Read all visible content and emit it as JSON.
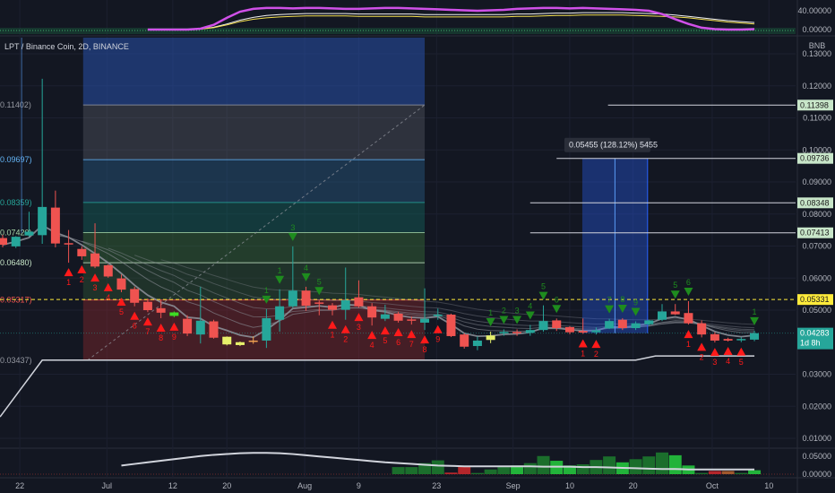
{
  "chart_data": {
    "type": "candlestick",
    "title": "LPT / Binance Coin, 2D, BINANCE",
    "currency": "BNB",
    "ylim": [
      0.005,
      0.13
    ],
    "y_ticks": [
      "0.13000",
      "0.12000",
      "0.11000",
      "0.10000",
      "0.09000",
      "0.08000",
      "0.07000",
      "0.06000",
      "0.05000",
      "0.03000",
      "0.02000",
      "0.01000"
    ],
    "y_tick_values": [
      0.13,
      0.12,
      0.11,
      0.1,
      0.09,
      0.08,
      0.07,
      0.06,
      0.05,
      0.03,
      0.02,
      0.01
    ],
    "x_ticks": [
      {
        "label": "22",
        "at_bar": 1.3
      },
      {
        "label": "Jul",
        "at_bar": 7.9
      },
      {
        "label": "12",
        "at_bar": 12.9
      },
      {
        "label": "20",
        "at_bar": 17
      },
      {
        "label": "Aug",
        "at_bar": 22.9
      },
      {
        "label": "9",
        "at_bar": 27
      },
      {
        "label": "23",
        "at_bar": 32.9
      },
      {
        "label": "Sep",
        "at_bar": 38.7
      },
      {
        "label": "10",
        "at_bar": 43
      },
      {
        "label": "20",
        "at_bar": 47.8
      },
      {
        "label": "Oct",
        "at_bar": 53.8
      },
      {
        "label": "10",
        "at_bar": 58.1
      }
    ],
    "candle_fields": [
      "open",
      "high",
      "low",
      "close"
    ],
    "candles": [
      [
        0.0725,
        0.0735,
        0.0696,
        0.0704
      ],
      [
        0.0699,
        0.0731,
        0.0694,
        0.0729
      ],
      [
        0.0733,
        0.0807,
        0.0729,
        0.0745
      ],
      [
        0.0734,
        0.1222,
        0.0707,
        0.0822
      ],
      [
        0.082,
        0.0873,
        0.0696,
        0.0708
      ],
      [
        0.0709,
        0.075,
        0.0648,
        0.0705
      ],
      [
        0.0691,
        0.0699,
        0.0657,
        0.0668
      ],
      [
        0.0677,
        0.0771,
        0.0631,
        0.0636
      ],
      [
        0.064,
        0.0643,
        0.0601,
        0.0605
      ],
      [
        0.0599,
        0.0611,
        0.0556,
        0.0564
      ],
      [
        0.0566,
        0.0573,
        0.0512,
        0.0523
      ],
      [
        0.0526,
        0.0536,
        0.0494,
        0.05
      ],
      [
        0.0506,
        0.0531,
        0.0475,
        0.0492
      ],
      [
        0.0482,
        0.0496,
        0.0478,
        0.0493
      ],
      [
        0.0473,
        0.0484,
        0.0419,
        0.0427
      ],
      [
        0.0424,
        0.0573,
        0.0396,
        0.0467
      ],
      [
        0.0465,
        0.047,
        0.0411,
        0.0414
      ],
      [
        0.0393,
        0.0418,
        0.039,
        0.0417
      ],
      [
        0.0391,
        0.0402,
        0.0388,
        0.04
      ],
      [
        0.0404,
        0.0418,
        0.0395,
        0.0405
      ],
      [
        0.0405,
        0.0503,
        0.0382,
        0.0475
      ],
      [
        0.047,
        0.0565,
        0.0433,
        0.0512
      ],
      [
        0.0512,
        0.0699,
        0.0508,
        0.0561
      ],
      [
        0.0561,
        0.0573,
        0.0498,
        0.0514
      ],
      [
        0.0524,
        0.053,
        0.0484,
        0.052
      ],
      [
        0.0515,
        0.0522,
        0.0484,
        0.0501
      ],
      [
        0.0501,
        0.0633,
        0.047,
        0.0531
      ],
      [
        0.054,
        0.0593,
        0.0508,
        0.0512
      ],
      [
        0.0512,
        0.0522,
        0.0452,
        0.0477
      ],
      [
        0.0473,
        0.0517,
        0.0466,
        0.0487
      ],
      [
        0.0489,
        0.0495,
        0.0461,
        0.0467
      ],
      [
        0.0471,
        0.048,
        0.0455,
        0.0468
      ],
      [
        0.0461,
        0.0568,
        0.0438,
        0.0473
      ],
      [
        0.0482,
        0.0505,
        0.047,
        0.0486
      ],
      [
        0.0486,
        0.0489,
        0.0416,
        0.0419
      ],
      [
        0.0424,
        0.0428,
        0.038,
        0.0386
      ],
      [
        0.0388,
        0.0418,
        0.0375,
        0.0405
      ],
      [
        0.0407,
        0.0433,
        0.0397,
        0.0421
      ],
      [
        0.0428,
        0.044,
        0.042,
        0.0432
      ],
      [
        0.0432,
        0.044,
        0.042,
        0.0428
      ],
      [
        0.0429,
        0.0454,
        0.042,
        0.0438
      ],
      [
        0.0438,
        0.0515,
        0.0433,
        0.0466
      ],
      [
        0.0468,
        0.0474,
        0.0435,
        0.0444
      ],
      [
        0.0447,
        0.045,
        0.0425,
        0.0431
      ],
      [
        0.0435,
        0.0474,
        0.0426,
        0.043
      ],
      [
        0.0431,
        0.0446,
        0.0424,
        0.0437
      ],
      [
        0.0443,
        0.0473,
        0.0441,
        0.0466
      ],
      [
        0.047,
        0.0475,
        0.0438,
        0.0444
      ],
      [
        0.0444,
        0.0465,
        0.0438,
        0.0459
      ],
      [
        0.0456,
        0.047,
        0.0452,
        0.0468
      ],
      [
        0.047,
        0.0519,
        0.0466,
        0.0496
      ],
      [
        0.0496,
        0.0519,
        0.0485,
        0.0487
      ],
      [
        0.0491,
        0.0528,
        0.0455,
        0.0459
      ],
      [
        0.0459,
        0.0468,
        0.0415,
        0.0424
      ],
      [
        0.0425,
        0.0431,
        0.0399,
        0.0405
      ],
      [
        0.041,
        0.0414,
        0.0402,
        0.0405
      ],
      [
        0.0407,
        0.0415,
        0.04,
        0.041
      ],
      [
        0.0408,
        0.0436,
        0.0403,
        0.0428
      ]
    ],
    "candle_color_overrides": {
      "13": "#3ddc24",
      "17": "#e6f06a",
      "18": "#e6f06a",
      "19": "#f0a050",
      "37": "#e6f06a"
    },
    "colors": {
      "up": "#26a69a",
      "down": "#ef5350",
      "buy": "#ff1a1a",
      "sell": "#1e8c1e",
      "ribbon": "#8a8d96",
      "support": "#d1d4dc"
    },
    "buy_signals": [
      [
        5,
        "1"
      ],
      [
        6,
        "2"
      ],
      [
        7,
        "3"
      ],
      [
        8,
        "4"
      ],
      [
        9,
        "5"
      ],
      [
        10,
        "6"
      ],
      [
        11,
        "7"
      ],
      [
        12,
        "8"
      ],
      [
        13,
        "9"
      ],
      [
        25,
        "1"
      ],
      [
        26,
        "2"
      ],
      [
        27,
        "3"
      ],
      [
        28,
        "4"
      ],
      [
        29,
        "5"
      ],
      [
        30,
        "6"
      ],
      [
        31,
        "7"
      ],
      [
        32,
        "8"
      ],
      [
        33,
        "9"
      ],
      [
        44,
        "1"
      ],
      [
        45,
        "2"
      ],
      [
        52,
        "1"
      ],
      [
        53,
        "2"
      ],
      [
        54,
        "3"
      ],
      [
        55,
        "4"
      ],
      [
        56,
        "5"
      ]
    ],
    "sell_signals": [
      [
        20,
        "1"
      ],
      [
        21,
        "1"
      ],
      [
        22,
        "3"
      ],
      [
        23,
        "4"
      ],
      [
        24,
        "5"
      ],
      [
        37,
        "1"
      ],
      [
        38,
        "2"
      ],
      [
        39,
        "3"
      ],
      [
        40,
        "4"
      ],
      [
        41,
        "5"
      ],
      [
        42,
        "6"
      ],
      [
        46,
        "7"
      ],
      [
        47,
        "8"
      ],
      [
        48,
        "9"
      ],
      [
        51,
        "5"
      ],
      [
        52,
        "6"
      ],
      [
        57,
        "1"
      ]
    ],
    "support_line": [
      [
        -0.2,
        0.0167
      ],
      [
        3,
        0.0344
      ],
      [
        48,
        0.0344
      ],
      [
        49.5,
        0.0357
      ],
      [
        57,
        0.0357
      ]
    ],
    "fib_levels": [
      {
        "label": "0.11402)",
        "value": 0.11402,
        "color": "#9598a1",
        "band": "rgba(120,123,134,0.28)"
      },
      {
        "label": "0.09697)",
        "value": 0.09697,
        "color": "#64b5f6",
        "band": "rgba(40,90,130,0.45)"
      },
      {
        "label": "0.08359)",
        "value": 0.08359,
        "color": "#26a69a",
        "band": "rgba(20,110,100,0.40)"
      },
      {
        "label": "0.07420)",
        "value": 0.0742,
        "color": "#a5d6a7",
        "band": "rgba(60,120,60,0.40)"
      },
      {
        "label": "0.06480)",
        "value": 0.0648,
        "color": "#c8e6c9",
        "band": "rgba(60,110,60,0.32)"
      },
      {
        "label": "0.05317)",
        "value": 0.05317,
        "color": "#ef5350",
        "band": "rgba(130,40,45,0.45)"
      },
      {
        "label": "0.03437)",
        "value": 0.03437,
        "color": "#9598a1",
        "band": null
      }
    ],
    "fib_start_bar": 6.1,
    "fib_end_bar": 32,
    "fib_top_band_color": "rgba(40,80,170,0.55)",
    "horizontal_lines": [
      {
        "label": "0.11398",
        "value": 0.11398,
        "from_bar": 45.9
      },
      {
        "label": "0.09736",
        "value": 0.09736,
        "from_bar": 42
      },
      {
        "label": "0.08348",
        "value": 0.08348,
        "from_bar": 40
      },
      {
        "label": "0.07413",
        "value": 0.07413,
        "from_bar": 40
      }
    ],
    "alert_line": {
      "label": "0.05331",
      "value": 0.05331,
      "color": "#ffeb3b"
    },
    "last_price": {
      "label": "0.04283",
      "value": 0.04283,
      "countdown": "1d 8h",
      "color": "#26a69a"
    },
    "measure": {
      "from_bar": 43.95,
      "to_bar": 48.9,
      "top": 0.09736,
      "bottom": 0.04281,
      "label": "0.05455 (128.12%) 5455"
    },
    "oscillator": {
      "ticks": [
        "40.00000",
        "0.00000"
      ],
      "start_bar": 11,
      "purple": [
        0,
        0,
        0,
        0,
        2,
        10,
        25,
        38,
        44,
        46,
        46,
        45,
        46,
        46,
        45,
        44,
        44,
        45,
        46,
        46,
        45,
        44,
        43,
        42,
        41,
        40,
        41,
        42,
        44,
        45,
        46,
        46,
        45,
        46,
        45,
        44,
        43,
        42,
        40,
        33,
        22,
        12,
        4,
        1,
        0,
        0,
        1
      ],
      "white": [
        0,
        0,
        0,
        0,
        1,
        5,
        12,
        20,
        26,
        30,
        32,
        33,
        34,
        34,
        34,
        34,
        33,
        33,
        33,
        33,
        33,
        32,
        32,
        32,
        32,
        32,
        32,
        32,
        33,
        33,
        34,
        35,
        35,
        36,
        36,
        36,
        36,
        35,
        34,
        33,
        31,
        28,
        25,
        22,
        19,
        17,
        15
      ],
      "yellow": [
        0,
        0,
        0,
        0,
        1,
        4,
        10,
        17,
        22,
        25,
        27,
        28,
        29,
        29,
        29,
        29,
        28,
        28,
        28,
        28,
        28,
        27,
        27,
        27,
        27,
        27,
        27,
        27,
        28,
        28,
        29,
        30,
        30,
        31,
        31,
        31,
        31,
        30,
        29,
        28,
        27,
        25,
        22,
        19,
        16,
        14,
        12
      ]
    },
    "volume": {
      "ticks": [
        "0.05000",
        "0.00000"
      ],
      "start_bar": 30,
      "values": [
        0.018,
        0.018,
        0.028,
        0.035,
        0.004,
        0.02,
        0.003,
        0.012,
        0.018,
        0.022,
        0.028,
        0.046,
        0.034,
        0.022,
        0.025,
        0.036,
        0.045,
        0.03,
        0.038,
        0.045,
        0.055,
        0.048,
        0.022,
        0.003,
        0.008,
        0.008,
        0.003,
        0.01
      ],
      "kinds": [
        "d",
        "d",
        "d",
        "d",
        "r",
        "r",
        "d",
        "d",
        "d",
        "b",
        "d",
        "d",
        "b",
        "b",
        "d",
        "d",
        "d",
        "b",
        "d",
        "d",
        "d",
        "b",
        "b",
        "d",
        "r",
        "o",
        "d",
        "b"
      ],
      "kind_colors": {
        "d": "#1b6e2c",
        "b": "#22b33a",
        "r": "#b3262b",
        "o": "#a0582d"
      },
      "ma_start_bar": 9,
      "ma": [
        0.022,
        0.026,
        0.03,
        0.034,
        0.038,
        0.042,
        0.046,
        0.049,
        0.051,
        0.053,
        0.054,
        0.054,
        0.053,
        0.051,
        0.048,
        0.045,
        0.042,
        0.039,
        0.036,
        0.033,
        0.03,
        0.028,
        0.026,
        0.024,
        0.022,
        0.021,
        0.02,
        0.02,
        0.02,
        0.02,
        0.02,
        0.02,
        0.019,
        0.019,
        0.019,
        0.018,
        0.018,
        0.017,
        0.016,
        0.015,
        0.014,
        0.013,
        0.013,
        0.012,
        0.012,
        0.012,
        0.012,
        0.012,
        0.012
      ]
    }
  }
}
